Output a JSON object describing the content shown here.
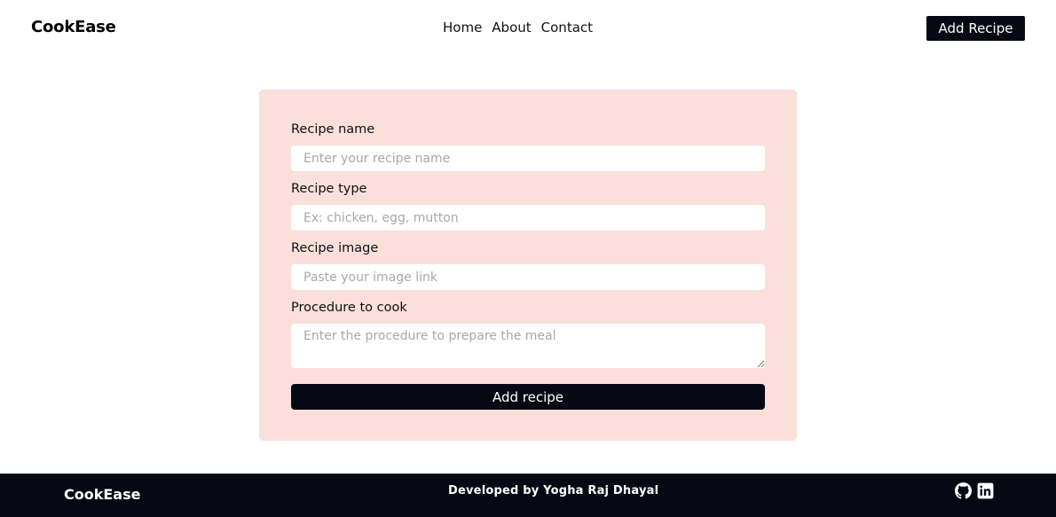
{
  "navbar": {
    "brand": "CookEase",
    "links": [
      "Home",
      "About",
      "Contact"
    ],
    "add_button": "Add Recipe"
  },
  "form": {
    "name_label": "Recipe name",
    "name_placeholder": "Enter your recipe name",
    "type_label": "Recipe type",
    "type_placeholder": "Ex: chicken, egg, mutton",
    "image_label": "Recipe image",
    "image_placeholder": "Paste your image link",
    "procedure_label": "Procedure to cook",
    "procedure_placeholder": "Enter the procedure to prepare the meal",
    "submit_label": "Add recipe"
  },
  "footer": {
    "brand": "CookEase",
    "credit": "Developed by Yogha Raj Dhayal",
    "icons": [
      "github-icon",
      "linkedin-icon"
    ]
  },
  "colors": {
    "dark": "#060913",
    "card_background": "#fadfdb",
    "placeholder": "#a8a8a8"
  }
}
